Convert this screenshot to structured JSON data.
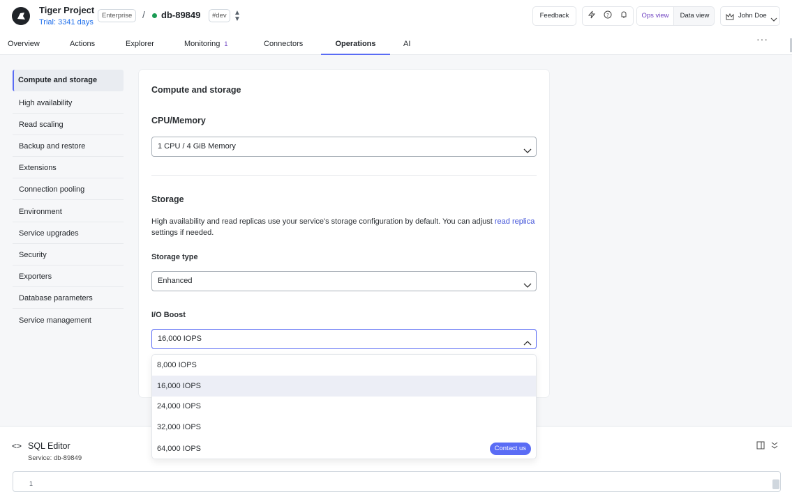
{
  "header": {
    "project_title": "Tiger Project",
    "trial_text": "Trial: 3341 days",
    "plan_badge": "Enterprise",
    "separator": "/",
    "service_name": "db-89849",
    "env_badge": "#dev",
    "feedback_label": "Feedback",
    "ops_view_label": "Ops view",
    "data_view_label": "Data view",
    "user_name": "John Doe",
    "status_color": "#1a9b53",
    "accent_color": "#5a6cf5"
  },
  "tabs": [
    {
      "label": "Overview"
    },
    {
      "label": "Actions"
    },
    {
      "label": "Explorer"
    },
    {
      "label": "Monitoring",
      "count": "1"
    },
    {
      "label": "Connectors"
    },
    {
      "label": "Operations"
    },
    {
      "label": "AI"
    }
  ],
  "sidebar": {
    "items": [
      {
        "label": "Compute and storage"
      },
      {
        "label": "High availability"
      },
      {
        "label": "Read scaling"
      },
      {
        "label": "Backup and restore"
      },
      {
        "label": "Extensions"
      },
      {
        "label": "Connection pooling"
      },
      {
        "label": "Environment"
      },
      {
        "label": "Service upgrades"
      },
      {
        "label": "Security"
      },
      {
        "label": "Exporters"
      },
      {
        "label": "Database parameters"
      },
      {
        "label": "Service management"
      }
    ]
  },
  "main": {
    "title": "Compute and storage",
    "cpu_heading": "CPU/Memory",
    "cpu_value": "1 CPU / 4 GiB Memory",
    "storage_heading": "Storage",
    "storage_desc_before": "High availability and read replicas use your service's storage configuration by default. You can adjust ",
    "storage_desc_link": "read replica",
    "storage_desc_after": " settings if needed.",
    "storage_type_label": "Storage type",
    "storage_type_value": "Enhanced",
    "io_boost_label": "I/O Boost",
    "io_boost_value": "16,000 IOPS",
    "io_options": [
      {
        "label": "8,000 IOPS"
      },
      {
        "label": "16,000 IOPS"
      },
      {
        "label": "24,000 IOPS"
      },
      {
        "label": "32,000 IOPS"
      },
      {
        "label": "64,000 IOPS",
        "pill": "Contact us"
      }
    ]
  },
  "sql_editor": {
    "title": "SQL Editor",
    "service_line": "Service: db-89849",
    "line_number": "1"
  }
}
